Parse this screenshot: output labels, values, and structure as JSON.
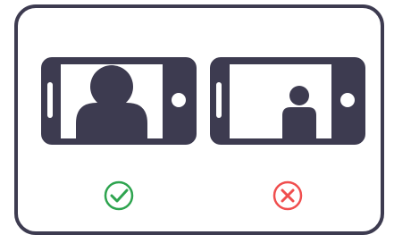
{
  "colors": {
    "frame": "#3d3b50",
    "phone": "#3d3b50",
    "screen": "#ffffff",
    "check": "#2ea44f",
    "cross": "#f04e4e"
  },
  "icons": {
    "good": "check-circle-icon",
    "bad": "x-circle-icon"
  }
}
